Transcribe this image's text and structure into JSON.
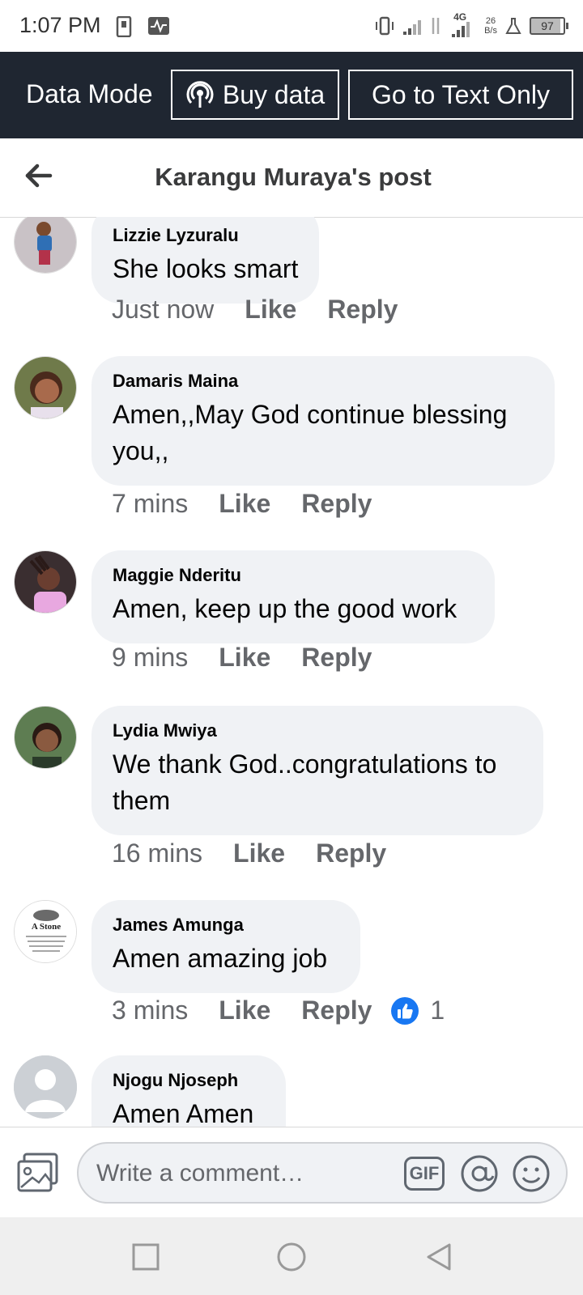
{
  "status_bar": {
    "time": "1:07 PM",
    "network": "4G",
    "speed_value": "26",
    "speed_unit": "B/s",
    "battery": "97"
  },
  "data_mode": {
    "label": "Data Mode",
    "buy_data": "Buy data",
    "text_only": "Go to Text Only"
  },
  "header": {
    "title": "Karangu Muraya's post"
  },
  "comments": [
    {
      "name": "Lizzie Lyzuralu",
      "text": "She looks smart",
      "time": "Just now",
      "like": "Like",
      "reply": "Reply"
    },
    {
      "name": "Damaris Maina",
      "text": "Amen,,May God  continue blessing you,,",
      "time": "7 mins",
      "like": "Like",
      "reply": "Reply"
    },
    {
      "name": "Maggie Nderitu",
      "text": "Amen, keep up the good work",
      "time": "9 mins",
      "like": "Like",
      "reply": "Reply"
    },
    {
      "name": "Lydia Mwiya",
      "text": "We thank God..congratulations to them",
      "time": "16 mins",
      "like": "Like",
      "reply": "Reply"
    },
    {
      "name": "James Amunga",
      "text": "Amen amazing job",
      "time": "3 mins",
      "like": "Like",
      "reply": "Reply",
      "reactions": "1",
      "avatar_text": "A Stone"
    },
    {
      "name": "Njogu Njoseph",
      "text": "Amen Amen"
    }
  ],
  "composer": {
    "placeholder": "Write a comment…",
    "gif_label": "GIF"
  },
  "colors": {
    "data_bar": "#1f2631",
    "bubble": "#f0f2f5",
    "like_blue": "#1877f2",
    "meta_gray": "#65676b"
  },
  "icons": [
    "vibrate-icon",
    "signal-icon",
    "battery-icon",
    "back-arrow-icon",
    "photo-icon",
    "at-icon",
    "emoji-icon",
    "like-icon",
    "home-icon",
    "recents-icon",
    "nav-back-icon"
  ]
}
